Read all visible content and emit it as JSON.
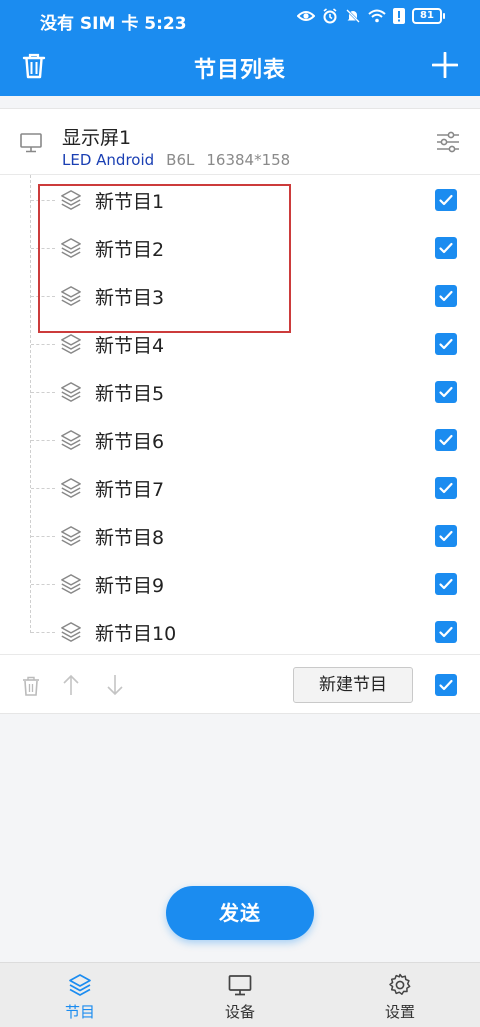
{
  "status_bar": {
    "carrier_time": "没有 SIM 卡 5:23",
    "battery": "81"
  },
  "header": {
    "title": "节目列表"
  },
  "device": {
    "name": "显示屏1",
    "platform": "LED Android",
    "model": "B6L",
    "resolution": "16384*158"
  },
  "programs": [
    {
      "label": "新节目1",
      "checked": true
    },
    {
      "label": "新节目2",
      "checked": true
    },
    {
      "label": "新节目3",
      "checked": true
    },
    {
      "label": "新节目4",
      "checked": true
    },
    {
      "label": "新节目5",
      "checked": true
    },
    {
      "label": "新节目6",
      "checked": true
    },
    {
      "label": "新节目7",
      "checked": true
    },
    {
      "label": "新节目8",
      "checked": true
    },
    {
      "label": "新节目9",
      "checked": true
    },
    {
      "label": "新节目10",
      "checked": true
    }
  ],
  "actions": {
    "new_program_label": "新建节目",
    "select_all_checked": true
  },
  "send_label": "发送",
  "bottom_nav": [
    {
      "label": "节目",
      "icon": "layers-icon",
      "active": true
    },
    {
      "label": "设备",
      "icon": "monitor-icon",
      "active": false
    },
    {
      "label": "设置",
      "icon": "gear-icon",
      "active": false
    }
  ],
  "colors": {
    "accent": "#1b8cf0",
    "highlight": "#cc3b3b",
    "platform_text": "#1a3fb3"
  }
}
